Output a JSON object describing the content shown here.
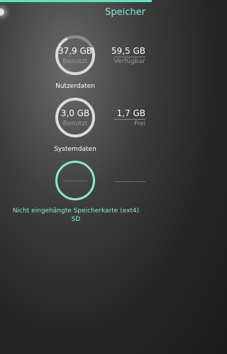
{
  "header": {
    "title": "Speicher",
    "accent_color": "#5fe0c5"
  },
  "user_data": {
    "used_value": "37,9 GB",
    "used_label": "Benutzt",
    "side_value": "59,5 GB",
    "side_label": "Verfügbar",
    "caption": "Nutzerdaten"
  },
  "system_data": {
    "used_value": "3,0 GB",
    "used_label": "Benutzt",
    "side_value": "1,7 GB",
    "side_label": "Frei",
    "caption": "Systemdaten"
  },
  "sd_card": {
    "caption": "Nicht eingehängte Speicherkarte (ext4)",
    "name": "SD"
  }
}
